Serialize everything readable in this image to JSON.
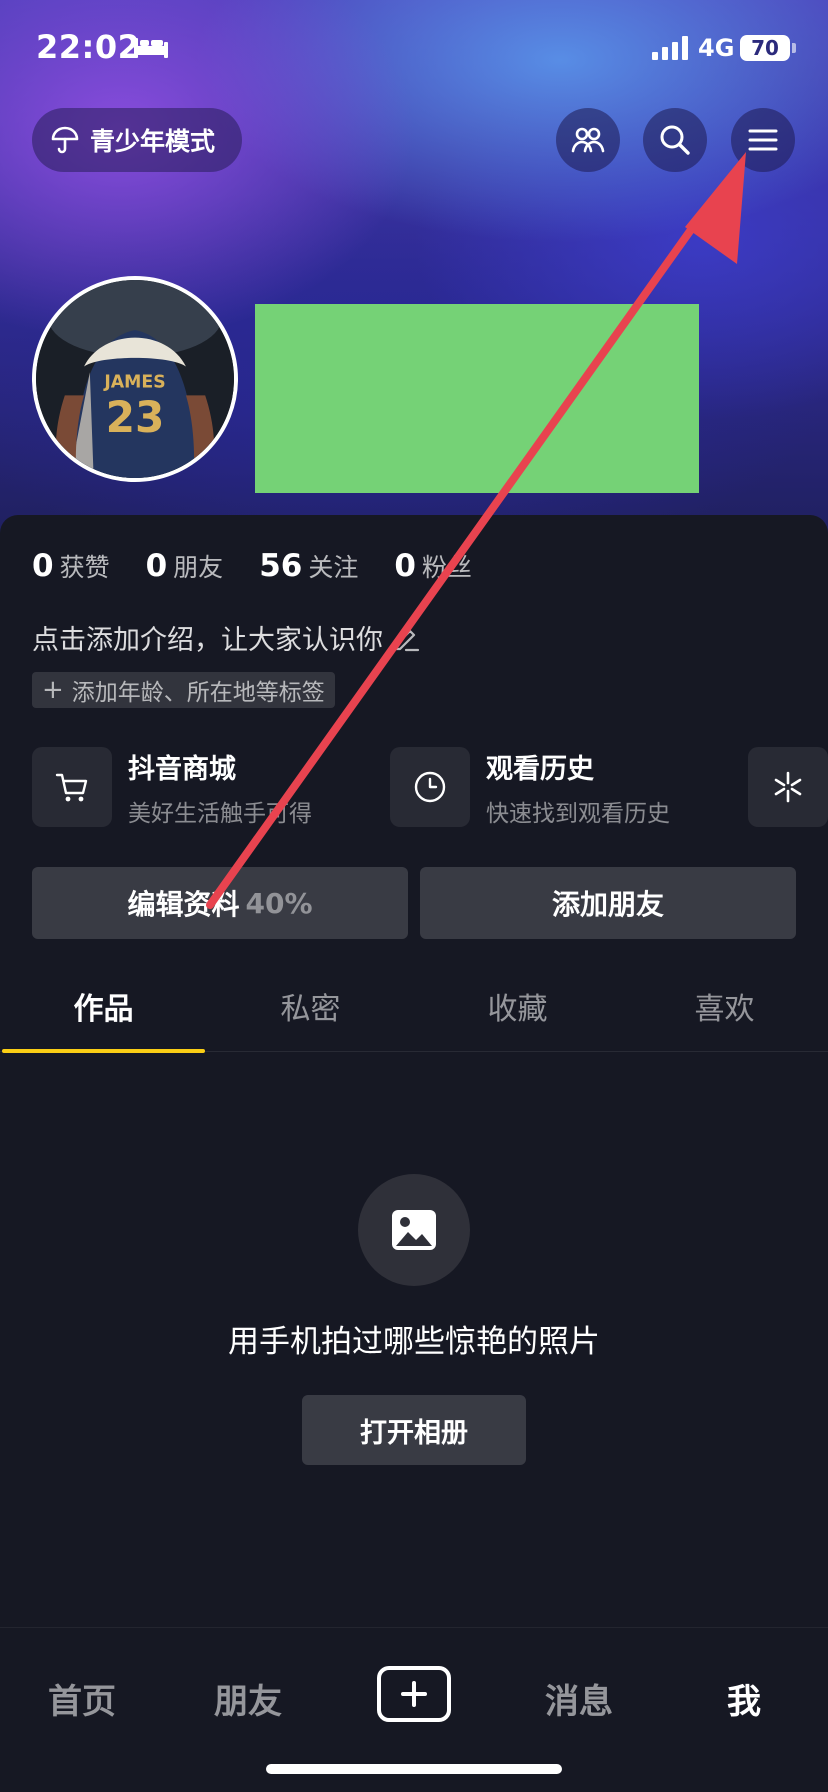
{
  "status_bar": {
    "time": "22:02",
    "network": "4G",
    "battery": "70"
  },
  "top_bar": {
    "youth_mode_label": "青少年模式"
  },
  "stats": [
    {
      "value": "0",
      "label": "获赞"
    },
    {
      "value": "0",
      "label": "朋友"
    },
    {
      "value": "56",
      "label": "关注"
    },
    {
      "value": "0",
      "label": "粉丝"
    }
  ],
  "profile": {
    "intro_text": "点击添加介绍，让大家认识你",
    "tag_text": "添加年龄、所在地等标签"
  },
  "shortcuts": [
    {
      "title": "抖音商城",
      "subtitle": "美好生活触手可得"
    },
    {
      "title": "观看历史",
      "subtitle": "快速找到观看历史"
    }
  ],
  "actions": {
    "edit_profile_label": "编辑资料",
    "edit_profile_percent": "40%",
    "add_friend_label": "添加朋友"
  },
  "tabs": [
    "作品",
    "私密",
    "收藏",
    "喜欢"
  ],
  "empty_state": {
    "message": "用手机拍过哪些惊艳的照片",
    "button_label": "打开相册"
  },
  "bottom_nav": {
    "home": "首页",
    "friends": "朋友",
    "messages": "消息",
    "me": "我"
  },
  "colors": {
    "accent_tab_underline": "#face15",
    "annotation_arrow": "#e8434f",
    "redaction_block": "#75d276",
    "background": "#161823"
  }
}
